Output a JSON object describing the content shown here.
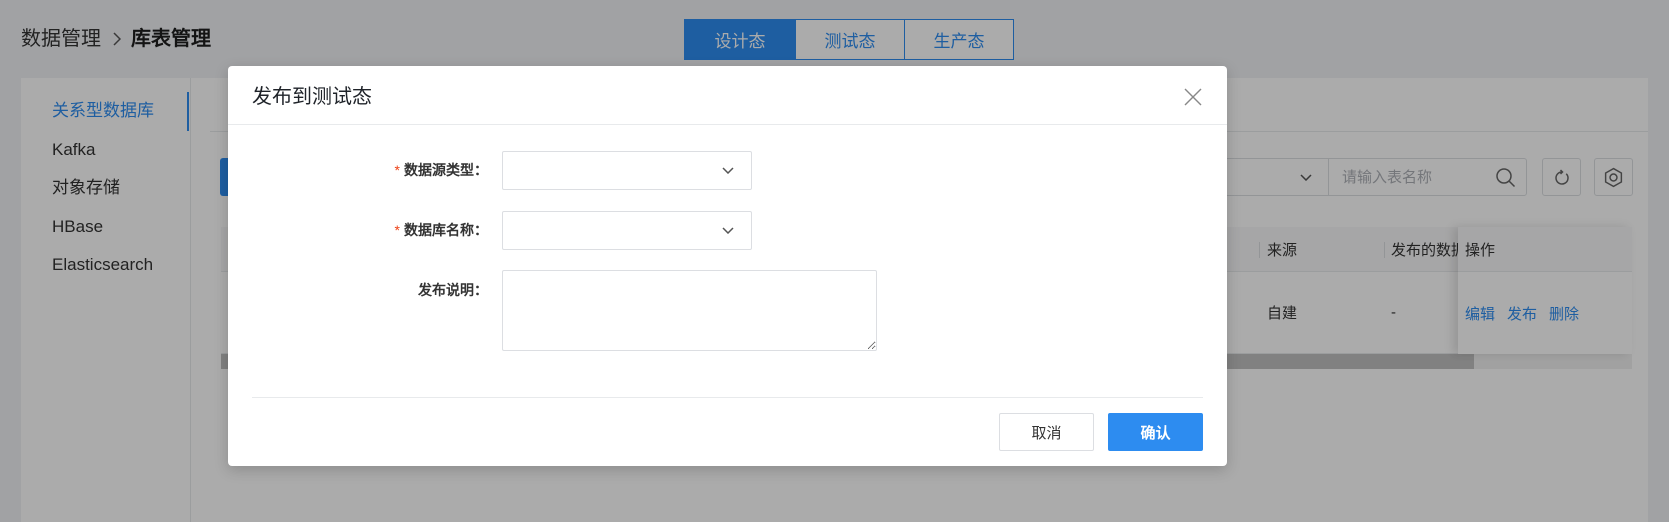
{
  "breadcrumb": {
    "parent": "数据管理",
    "current": "库表管理"
  },
  "env_tabs": [
    {
      "label": "设计态",
      "active": true
    },
    {
      "label": "测试态",
      "active": false
    },
    {
      "label": "生产态",
      "active": false
    }
  ],
  "sidebar": {
    "items": [
      {
        "label": "关系型数据库",
        "active": true
      },
      {
        "label": "Kafka",
        "active": false
      },
      {
        "label": "对象存储",
        "active": false
      },
      {
        "label": "HBase",
        "active": false
      },
      {
        "label": "Elasticsearch",
        "active": false
      }
    ]
  },
  "toolbar": {
    "search_placeholder": "请输入表名称"
  },
  "table": {
    "columns": [
      "来源",
      "发布的数据",
      "操作"
    ],
    "rows": [
      {
        "source": "自建",
        "published": "-",
        "actions": [
          "编辑",
          "发布",
          "删除"
        ]
      }
    ]
  },
  "modal": {
    "title": "发布到测试态",
    "required_mark": "*",
    "fields": [
      {
        "label": "数据源类型：",
        "required": true
      },
      {
        "label": "数据库名称：",
        "required": true
      },
      {
        "label": "发布说明：",
        "required": false
      }
    ],
    "cancel_label": "取消",
    "confirm_label": "确认"
  },
  "icons": {
    "breadcrumb_separator": "chevron-right-icon",
    "select_arrow": "chevron-down-icon",
    "close": "close-icon",
    "search": "search-icon",
    "refresh": "refresh-icon",
    "settings": "settings-icon"
  },
  "colors": {
    "accent": "#2d8cf0",
    "required": "#ed4014"
  }
}
